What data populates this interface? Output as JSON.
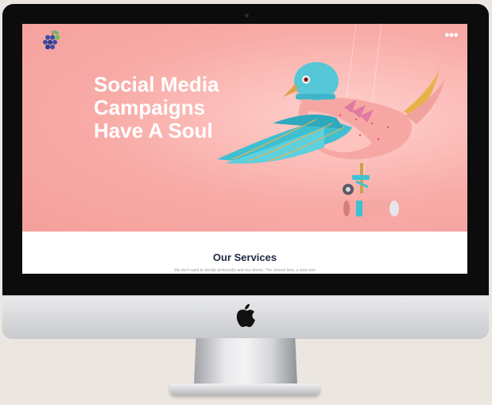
{
  "hero": {
    "headline_lines": [
      "Social Media",
      "Campaigns",
      "Have A Soul"
    ],
    "menu_icon": "ellipsis-menu-icon"
  },
  "services": {
    "title": "Our Services",
    "subtitle": "We don't want to decide profoundly and our clients. The closest time, a slow-one"
  },
  "brand": {
    "logo": "grape-cluster-logo",
    "monitor_logo": "apple-icon"
  },
  "colors": {
    "hero_bg": "#f4a09c",
    "headline": "#ffffff",
    "services_title": "#1f2a44"
  }
}
